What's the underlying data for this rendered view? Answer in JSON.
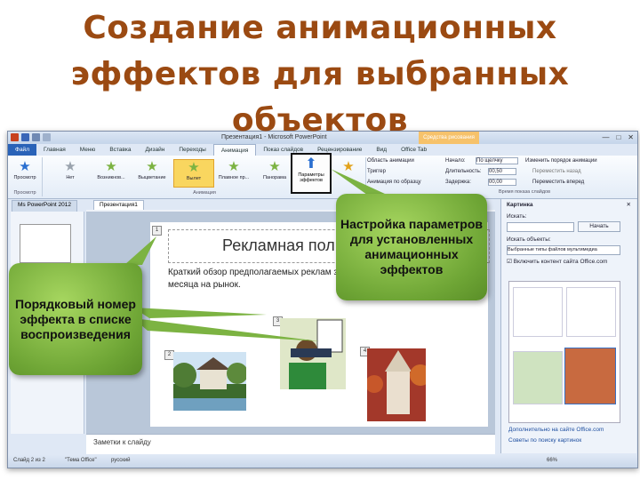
{
  "slide": {
    "title": "Создание анимационных эффектов для выбранных объектов"
  },
  "window": {
    "title": "Презентация1 - Microsoft PowerPoint",
    "context_tab": "Средства рисования",
    "controls": [
      "—",
      "□",
      "✕"
    ]
  },
  "ribbon_tabs": [
    "Файл",
    "Главная",
    "Меню",
    "Вставка",
    "Дизайн",
    "Переходы",
    "Анимация",
    "Показ слайдов",
    "Рецензирование",
    "Вид",
    "Office Tab"
  ],
  "ribbon_active_tab": "Анимация",
  "ribbon": {
    "preview": {
      "label": "Просмотр",
      "group": "Просмотр"
    },
    "animations": [
      {
        "label": "Нет",
        "state": "grey"
      },
      {
        "label": "Возникнов...",
        "state": "normal"
      },
      {
        "label": "Выцветание",
        "state": "normal"
      },
      {
        "label": "Вылет",
        "state": "selected"
      },
      {
        "label": "Плавное пр...",
        "state": "normal"
      },
      {
        "label": "Панорама",
        "state": "normal"
      }
    ],
    "animation_group": "Анимация",
    "effect_params": "Параметры эффектов",
    "add_animation": "Добавить анимацию",
    "extended": [
      "Область анимации",
      "Триггер",
      "Анимация по образцу"
    ],
    "timing": {
      "start_label": "Начало:",
      "start_value": "По щелчку",
      "duration_label": "Длительность:",
      "duration_value": "00,50",
      "delay_label": "Задержка:",
      "delay_value": "00,00",
      "reorder": "Изменить порядок анимации",
      "move_back": "Переместить назад",
      "move_forward": "Переместить вперед",
      "group": "Время показа слайдов"
    }
  },
  "doc_tabs": [
    "Ms PowerPoint 2012",
    "Презентация1"
  ],
  "editor": {
    "slide_title": "Рекламная пол",
    "body": "Краткий обзор предполагаемых реклам запланированных на первые три месяца на рынок.",
    "markers": [
      "1",
      "2",
      "3",
      "4"
    ],
    "notes": "Заметки к слайду"
  },
  "clipart_pane": {
    "title": "Картинка",
    "search_label": "Искать:",
    "search_button": "Начать",
    "find_label": "Искать объекты:",
    "find_value": "Выбранные типы файлов мультимедиа",
    "include_online": "Включить контент сайта Office.com",
    "more_link": "Дополнительно на сайте Office.com",
    "tips_link": "Советы по поиску картинок"
  },
  "status": {
    "slide": "Слайд 2 из 2",
    "theme": "\"Тема Office\"",
    "language": "русский",
    "zoom": "66%"
  },
  "callouts": {
    "params": "Настройка параметров для установленных анимационных эффектов",
    "order": "Порядковый номер эффекта в списке воспроизведения"
  },
  "colors": {
    "title": "#9b4a12",
    "callout": "#7cb342",
    "selected_effect": "#f9d65f"
  }
}
